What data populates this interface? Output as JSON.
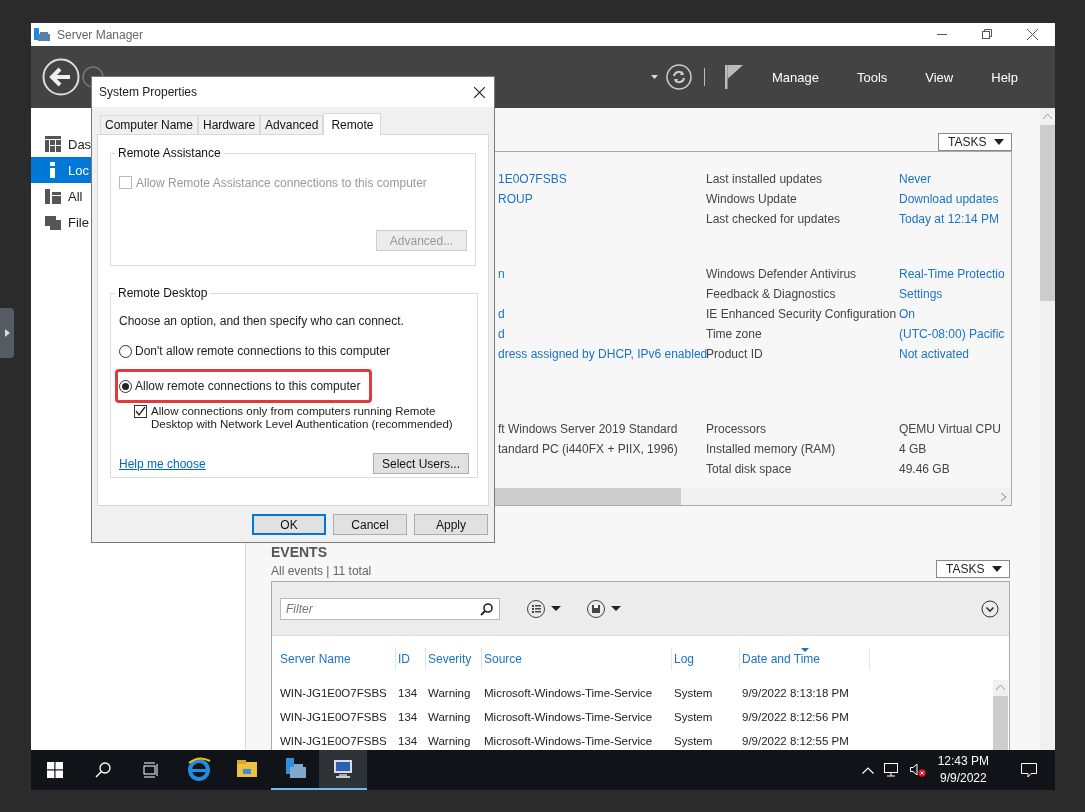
{
  "window": {
    "title": "Server Manager"
  },
  "header": {
    "menu": [
      "Manage",
      "Tools",
      "View",
      "Help"
    ]
  },
  "sidebar": {
    "items": [
      {
        "label": "Das",
        "selected": false
      },
      {
        "label": "Loc",
        "selected": true
      },
      {
        "label": "All",
        "selected": false
      },
      {
        "label": "File",
        "selected": false
      }
    ]
  },
  "properties": {
    "tasks": "TASKS",
    "groups": [
      [
        {
          "left": "1E0O7FSBS",
          "left_link": true,
          "label": "Last installed updates",
          "value": "Never",
          "value_link": true
        },
        {
          "left": "ROUP",
          "left_link": true,
          "label": "Windows Update",
          "value": "Download updates",
          "value_link": true
        },
        {
          "label": "Last checked for updates",
          "value": "Today at 12:14 PM",
          "value_link": true
        }
      ],
      [
        {
          "left": "n",
          "left_link": true,
          "label": "Windows Defender Antivirus",
          "value": "Real-Time Protectio",
          "value_link": true
        },
        {
          "label": "Feedback & Diagnostics",
          "value": "Settings",
          "value_link": true
        },
        {
          "left": "d",
          "left_link": true,
          "label": "IE Enhanced Security Configuration",
          "value": "On",
          "value_link": true
        },
        {
          "left": "d",
          "left_link": true,
          "label": "Time zone",
          "value": "(UTC-08:00) Pacific",
          "value_link": true
        },
        {
          "left": "dress assigned by DHCP, IPv6 enabled",
          "left_link": true,
          "label": "Product ID",
          "value": "Not activated",
          "value_link": true
        }
      ],
      [
        {
          "left": "ft Windows Server 2019 Standard",
          "left_link": false,
          "label": "Processors",
          "value": "QEMU Virtual CPU",
          "value_link": false
        },
        {
          "left": "tandard PC (i440FX + PIIX, 1996)",
          "left_link": false,
          "label": "Installed memory (RAM)",
          "value": "4 GB",
          "value_link": false
        },
        {
          "label": "Total disk space",
          "value": "49.46 GB",
          "value_link": false
        }
      ]
    ]
  },
  "dialog": {
    "title": "System Properties",
    "tabs": [
      {
        "label": "Computer Name",
        "selected": false
      },
      {
        "label": "Hardware",
        "selected": false
      },
      {
        "label": "Advanced",
        "selected": false
      },
      {
        "label": "Remote",
        "selected": true
      }
    ],
    "remote_assistance": {
      "legend": "Remote Assistance",
      "checkbox": {
        "label": "Allow Remote Assistance connections to this computer",
        "checked": false,
        "disabled": true
      },
      "button": {
        "label": "Advanced...",
        "disabled": true
      }
    },
    "remote_desktop": {
      "legend": "Remote Desktop",
      "intro": "Choose an option, and then specify who can connect.",
      "options": [
        {
          "label": "Don't allow remote connections to this computer",
          "selected": false,
          "highlighted": false
        },
        {
          "label": "Allow remote connections to this computer",
          "selected": true,
          "highlighted": true
        }
      ],
      "nla": {
        "label": "Allow connections only from computers running Remote Desktop with Network Level Authentication (recommended)",
        "checked": true,
        "disabled": false
      },
      "help_link": "Help me choose",
      "button": {
        "label": "Select Users...",
        "disabled": false
      }
    },
    "buttons": [
      {
        "label": "OK",
        "default": true
      },
      {
        "label": "Cancel",
        "default": false
      },
      {
        "label": "Apply",
        "default": false
      }
    ]
  },
  "events": {
    "title": "EVENTS",
    "subtitle": "All events | 11 total",
    "tasks": "TASKS",
    "filter": {
      "placeholder": "Filter"
    },
    "columns": [
      {
        "label": "Server Name",
        "sorted": false
      },
      {
        "label": "ID",
        "sorted": false
      },
      {
        "label": "Severity",
        "sorted": false
      },
      {
        "label": "Source",
        "sorted": false
      },
      {
        "label": "Log",
        "sorted": false
      },
      {
        "label": "Date and Time",
        "sorted": true
      }
    ],
    "rows": [
      [
        "WIN-JG1E0O7FSBS",
        "134",
        "Warning",
        "Microsoft-Windows-Time-Service",
        "System",
        "9/9/2022 8:13:18 PM"
      ],
      [
        "WIN-JG1E0O7FSBS",
        "134",
        "Warning",
        "Microsoft-Windows-Time-Service",
        "System",
        "9/9/2022 8:12:56 PM"
      ],
      [
        "WIN-JG1E0O7FSBS",
        "134",
        "Warning",
        "Microsoft-Windows-Time-Service",
        "System",
        "9/9/2022 8:12:55 PM"
      ]
    ]
  },
  "taskbar": {
    "apps": [
      {
        "running": false,
        "focused": false
      },
      {
        "running": false,
        "focused": false
      },
      {
        "running": true,
        "focused": false
      },
      {
        "running": true,
        "focused": true
      }
    ],
    "clock": {
      "time": "12:43 PM",
      "date": "9/9/2022"
    }
  }
}
